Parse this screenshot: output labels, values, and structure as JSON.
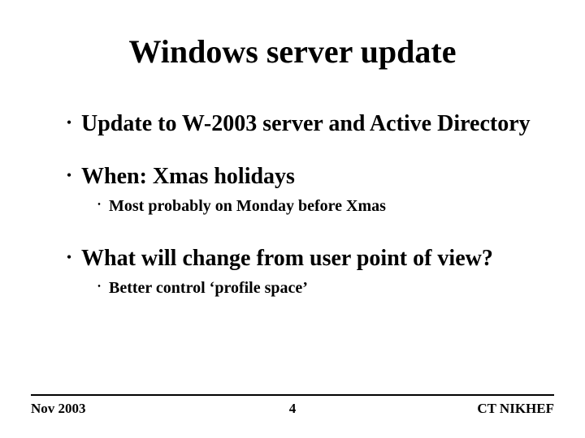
{
  "title": "Windows server update",
  "bullets": [
    {
      "text": "Update to W-2003 server and Active Directory",
      "sub": []
    },
    {
      "text": "When: Xmas holidays",
      "sub": [
        "Most probably on Monday before Xmas"
      ]
    },
    {
      "text": "What will change from user point of view?",
      "sub": [
        "Better control ‘profile space’"
      ]
    }
  ],
  "footer": {
    "left": "Nov 2003",
    "center": "4",
    "right": "CT NIKHEF"
  }
}
